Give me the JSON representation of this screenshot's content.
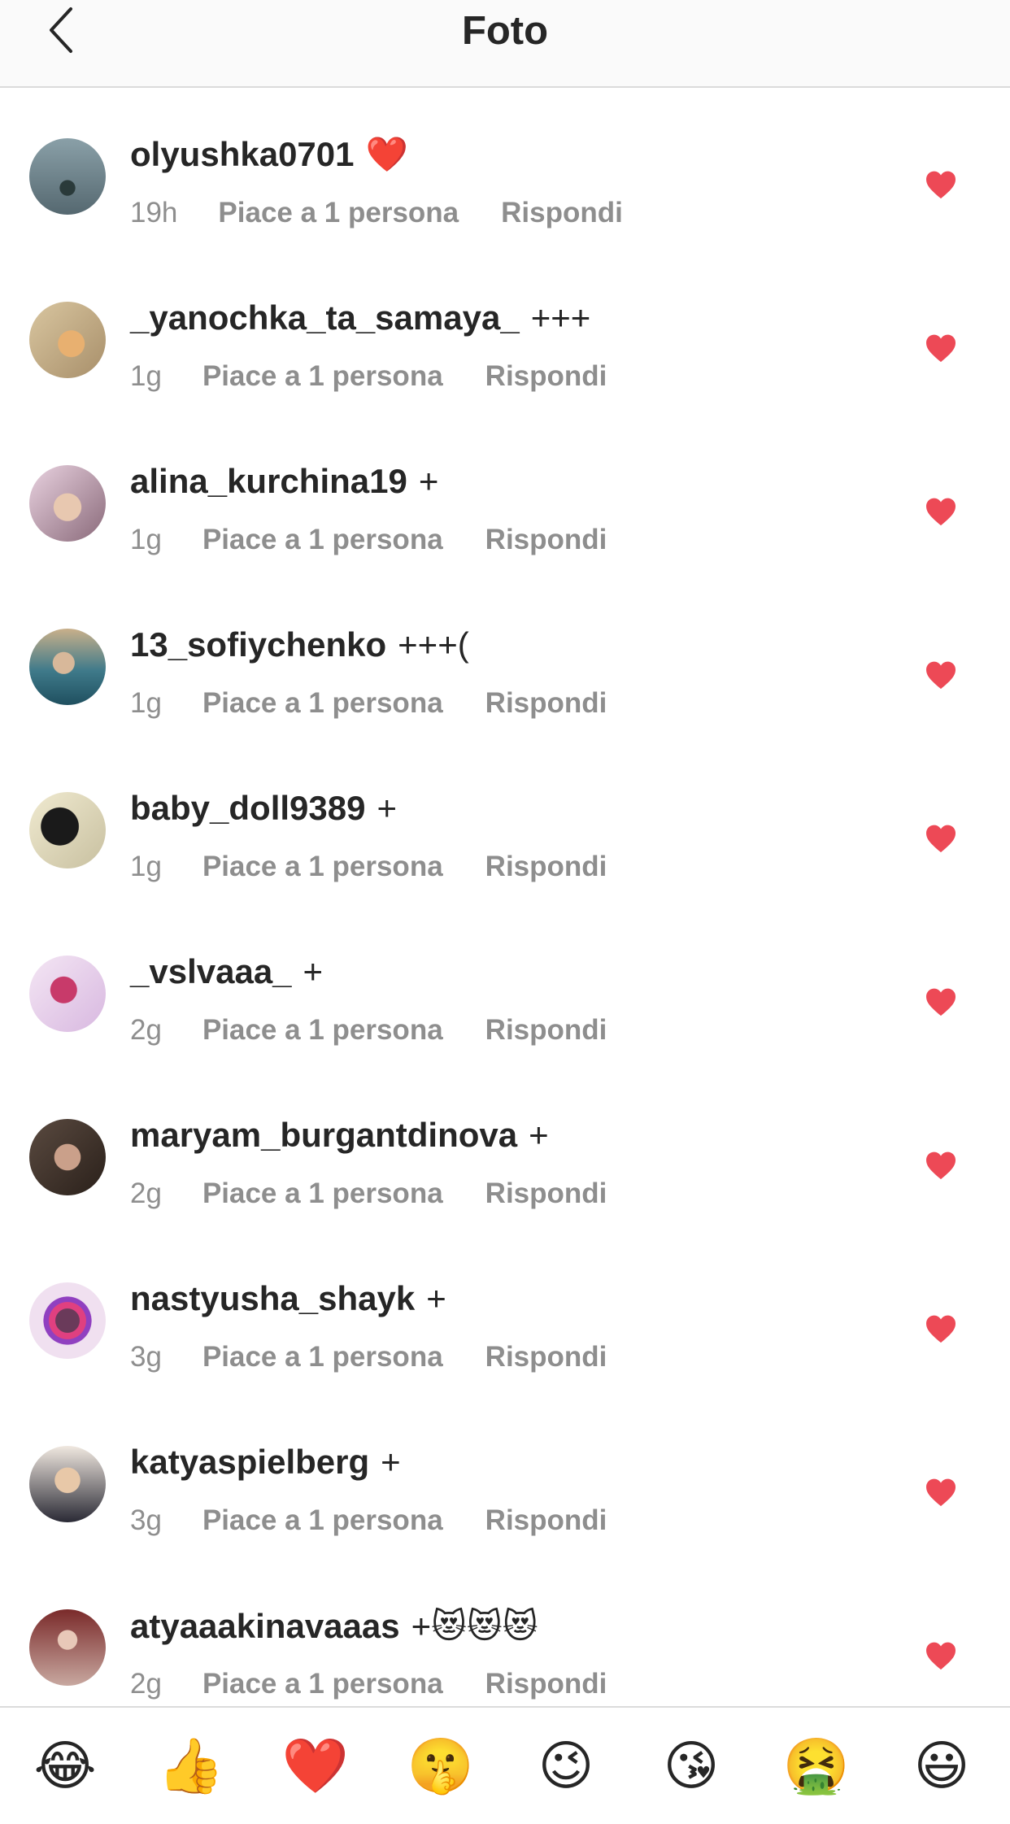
{
  "header": {
    "title": "Foto"
  },
  "comments": [
    {
      "username": "olyushka0701",
      "text": "❤️",
      "time": "19h",
      "likes": "Piace a 1 persona",
      "reply": "Rispondi"
    },
    {
      "username": "_yanochka_ta_samaya_",
      "text": "+++",
      "time": "1g",
      "likes": "Piace a 1 persona",
      "reply": "Rispondi"
    },
    {
      "username": "alina_kurchina19",
      "text": "+",
      "time": "1g",
      "likes": "Piace a 1 persona",
      "reply": "Rispondi"
    },
    {
      "username": "13_sofiychenko",
      "text": "+++(",
      "time": "1g",
      "likes": "Piace a 1 persona",
      "reply": "Rispondi"
    },
    {
      "username": "baby_doll9389",
      "text": "+",
      "time": "1g",
      "likes": "Piace a 1 persona",
      "reply": "Rispondi"
    },
    {
      "username": "_vslvaaa_",
      "text": "+",
      "time": "2g",
      "likes": "Piace a 1 persona",
      "reply": "Rispondi"
    },
    {
      "username": "maryam_burgantdinova",
      "text": "+",
      "time": "2g",
      "likes": "Piace a 1 persona",
      "reply": "Rispondi"
    },
    {
      "username": "nastyusha_shayk",
      "text": "+",
      "time": "3g",
      "likes": "Piace a 1 persona",
      "reply": "Rispondi"
    },
    {
      "username": "katyaspielberg",
      "text": "+",
      "time": "3g",
      "likes": "Piace a 1 persona",
      "reply": "Rispondi"
    },
    {
      "username": "atyaaakinavaaas",
      "text": "+😻😻😻",
      "time": "2g",
      "likes": "Piace a 1 persona",
      "reply": "Rispondi"
    }
  ],
  "emoji_bar": [
    "😂",
    "👍",
    "❤️",
    "🤫",
    "😉",
    "😘",
    "🤮",
    "😃"
  ],
  "colors": {
    "like_heart": "#ed4956",
    "meta_text": "#8e8e8e",
    "username": "#262626"
  }
}
